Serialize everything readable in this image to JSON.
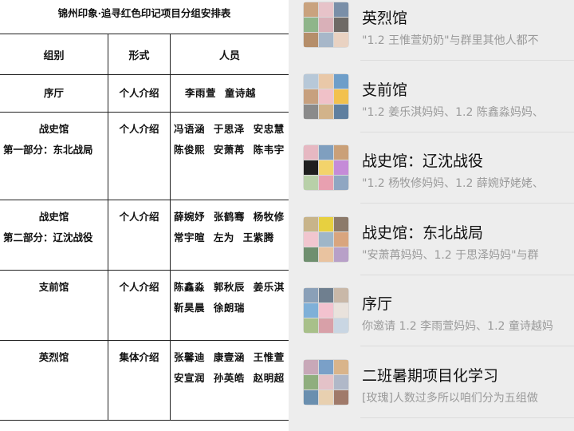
{
  "document": {
    "title": "锦州印象·追寻红色印记项目分组安排表",
    "headers": [
      "组别",
      "形式",
      "人员"
    ],
    "rows": [
      {
        "group": [
          "序厅"
        ],
        "form": "个人介绍",
        "people": [
          "李雨萱 童诗越"
        ]
      },
      {
        "group": [
          "战史馆",
          "第一部分：东北战局"
        ],
        "form": "个人介绍",
        "people": [
          "冯语涵 于思泽 安忠慧",
          "陈俊熙 安萧苒 陈韦宇"
        ]
      },
      {
        "group": [
          "战史馆",
          "第二部分：辽沈战役"
        ],
        "form": "个人介绍",
        "people": [
          "薛婉妤 张鹤骞 杨牧修",
          "常宇暄 左为 王紫腾"
        ]
      },
      {
        "group": [
          "支前馆"
        ],
        "form": "个人介绍",
        "people": [
          "陈鑫淼 郭秋辰 姜乐淇",
          "靳昊晨 徐朗瑞"
        ]
      },
      {
        "group": [
          "英烈馆"
        ],
        "form": "集体介绍",
        "people": [
          "张馨迪 康壹涵 王惟萱",
          "安宣润 孙英皓 赵明超"
        ]
      }
    ]
  },
  "chat_list": {
    "items": [
      {
        "name": "英烈馆",
        "preview": "\"1.2 王惟萱奶奶\"与群里其他人都不"
      },
      {
        "name": "支前馆",
        "preview": "\"1.2 姜乐淇妈妈、1.2 陈鑫淼妈妈、"
      },
      {
        "name": "战史馆：辽沈战役",
        "preview": "\"1.2 杨牧修妈妈、1.2 薛婉妤姥姥、"
      },
      {
        "name": "战史馆：东北战局",
        "preview": "\"安萧苒妈妈、1.2 于思泽妈妈\"与群"
      },
      {
        "name": "序厅",
        "preview": "你邀请 1.2 李雨萱妈妈、1.2 童诗越妈"
      },
      {
        "name": "二班暑期项目化学习",
        "preview": "[玫瑰]人数过多所以咱们分为五组做"
      }
    ],
    "avatar_colors": [
      [
        "#c9a27e",
        "#e7c3c9",
        "#7a8fa8",
        "#8fb58a",
        "#d9b0b8",
        "#6e6a66",
        "#b58e6a",
        "#a7b7c9",
        "#e9d2c2"
      ],
      [
        "#b7c8d8",
        "#e9c8a8",
        "#6e9ec9",
        "#c7a07e",
        "#f0c1c8",
        "#f2c14e",
        "#8a8a8a",
        "#d2b38a",
        "#5f7f9f"
      ],
      [
        "#e6b8c2",
        "#7f9fbf",
        "#caa078",
        "#1f1f1f",
        "#f3d36b",
        "#c58bd8",
        "#b8d0a8",
        "#e8a0b0",
        "#8fa6c2"
      ],
      [
        "#c8b48a",
        "#e7d040",
        "#8c7a6a",
        "#f1c6cf",
        "#9fb6c8",
        "#d9a57e",
        "#6f8f6f",
        "#e9c3a0",
        "#b8a0c8"
      ],
      [
        "#8aa0b8",
        "#6f7f8f",
        "#c9b8a8",
        "#7fb0d8",
        "#f3c2cf",
        "#e9e2dc",
        "#a8c08a",
        "#d8a0a8",
        "#c9d6e3"
      ],
      [
        "#c8a8b8",
        "#7aa0c8",
        "#d9b48a",
        "#8fae7e",
        "#e4c2c8",
        "#b0b8c8",
        "#6a8faf",
        "#e8d0b0",
        "#a07a6a"
      ]
    ]
  }
}
